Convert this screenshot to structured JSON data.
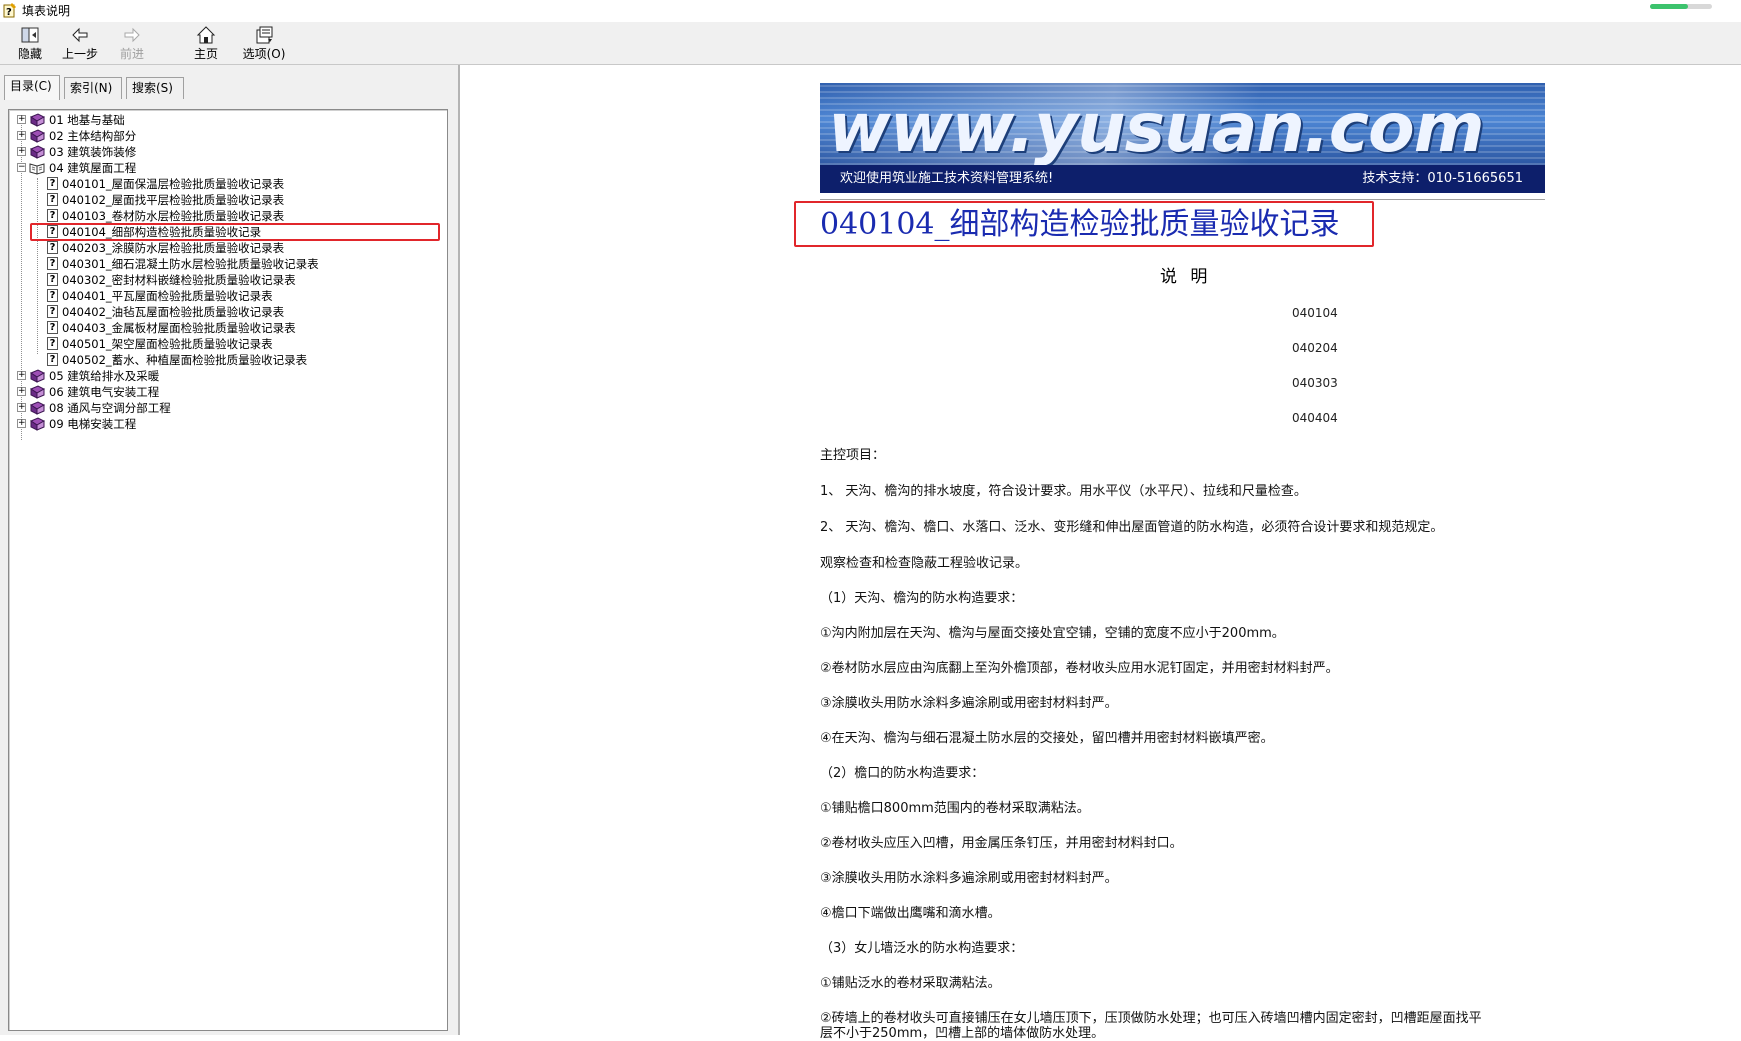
{
  "window": {
    "title": "填表说明"
  },
  "toolbar": {
    "hide": "隐藏",
    "back": "上一步",
    "forward": "前进",
    "home": "主页",
    "options": "选项(O)"
  },
  "tabs": [
    "目录(C)",
    "索引(N)",
    "搜索(S)"
  ],
  "tree": {
    "groups_top": [
      {
        "code": "01",
        "label": "01  地基与基础"
      },
      {
        "code": "02",
        "label": "02  主体结构部分"
      },
      {
        "code": "03",
        "label": "03  建筑装饰装修"
      },
      {
        "code": "04",
        "label": "04  建筑屋面工程"
      }
    ],
    "children": [
      "040101_屋面保温层检验批质量验收记录表",
      "040102_屋面找平层检验批质量验收记录表",
      "040103_卷材防水层检验批质量验收记录表",
      "040104_细部构造检验批质量验收记录",
      "040203_涂膜防水层检验批质量验收记录表",
      "040301_细石混凝土防水层检验批质量验收记录表",
      "040302_密封材料嵌缝检验批质量验收记录表",
      "040401_平瓦屋面检验批质量验收记录表",
      "040402_油毡瓦屋面检验批质量验收记录表",
      "040403_金属板材屋面检验批质量验收记录表",
      "040501_架空屋面检验批质量验收记录表",
      "040502_蓄水、种植屋面检验批质量验收记录表"
    ],
    "groups_bottom": [
      "05  建筑给排水及采暖",
      "06  建筑电气安装工程",
      "08  通风与空调分部工程",
      "09  电梯安装工程"
    ]
  },
  "banner": {
    "logo": "www.yusuan.com",
    "welcome": "欢迎使用筑业施工技术资料管理系统!",
    "support": "技术支持：010-51665651"
  },
  "doc": {
    "title": "040104_细部构造检验批质量验收记录",
    "subhead": "说  明",
    "codes": [
      "040104",
      "040204",
      "040303",
      "040404"
    ],
    "paragraphs": [
      "主控项目：",
      "1、 天沟、檐沟的排水坡度，符合设计要求。用水平仪（水平尺）、拉线和尺量检查。",
      "2、 天沟、檐沟、檐口、水落口、泛水、变形缝和伸出屋面管道的防水构造，必须符合设计要求和规范规定。",
      "观察检查和检查隐蔽工程验收记录。",
      "（1）天沟、檐沟的防水构造要求：",
      "①沟内附加层在天沟、檐沟与屋面交接处宜空铺，空铺的宽度不应小于200mm。",
      "②卷材防水层应由沟底翻上至沟外檐顶部，卷材收头应用水泥钉固定，并用密封材料封严。",
      "③涂膜收头用防水涂料多遍涂刷或用密封材料封严。",
      "④在天沟、檐沟与细石混凝土防水层的交接处，留凹槽并用密封材料嵌填严密。",
      "（2）檐口的防水构造要求：",
      "①铺贴檐口800mm范围内的卷材采取满粘法。",
      "②卷材收头应压入凹槽，用金属压条钉压，并用密封材料封口。",
      "③涂膜收头用防水涂料多遍涂刷或用密封材料封严。",
      "④檐口下端做出鹰嘴和滴水槽。",
      "（3）女儿墙泛水的防水构造要求：",
      "①铺贴泛水的卷材采取满粘法。",
      "②砖墙上的卷材收头可直接铺压在女儿墙压顶下，压顶做防水处理；也可压入砖墙凹槽内固定密封，凹槽距屋面找平",
      "层不小于250mm，凹槽上部的墙体做防水处理。"
    ]
  },
  "colors": {
    "highlight": "#e1262b",
    "title": "#1a2bb0",
    "banner_bar": "#0d1f6b"
  }
}
